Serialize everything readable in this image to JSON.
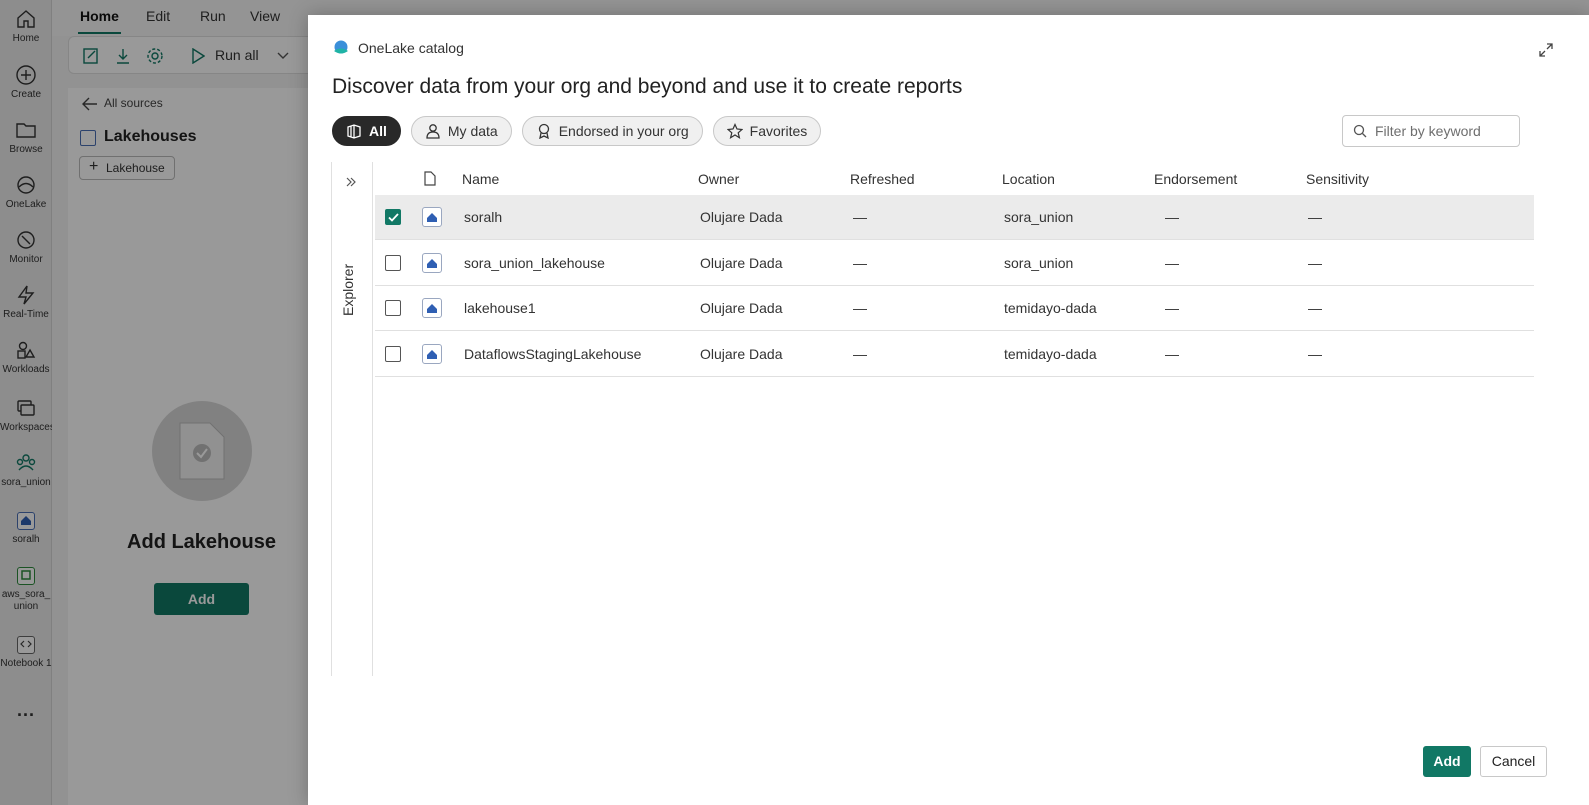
{
  "rail": {
    "items": [
      {
        "label": "Home",
        "icon": "home-icon"
      },
      {
        "label": "Create",
        "icon": "plus-circle-icon"
      },
      {
        "label": "Browse",
        "icon": "folder-icon"
      },
      {
        "label": "OneLake",
        "icon": "onelake-icon"
      },
      {
        "label": "Monitor",
        "icon": "monitor-icon"
      },
      {
        "label": "Real-Time",
        "icon": "lightning-icon"
      },
      {
        "label": "Workloads",
        "icon": "workloads-icon"
      },
      {
        "label": "Workspaces",
        "icon": "workspaces-icon"
      },
      {
        "label": "sora_union",
        "icon": "workspace-people-icon"
      },
      {
        "label": "soralh",
        "icon": "lakehouse-icon"
      },
      {
        "label": "aws_sora_union",
        "icon": "dataflow-icon"
      },
      {
        "label": "Notebook 1",
        "icon": "notebook-icon"
      }
    ],
    "more": "..."
  },
  "menubar": {
    "tabs": [
      "Home",
      "Edit",
      "Run",
      "View"
    ],
    "active_tab": "Home"
  },
  "toolbar": {
    "run_all": "Run all"
  },
  "left_panel": {
    "back_link": "All sources",
    "title": "Lakehouses",
    "add_chip": "Lakehouse",
    "empty_title": "Add Lakehouse",
    "add_button": "Add"
  },
  "dialog": {
    "header": "OneLake catalog",
    "title": "Discover data from your org and beyond and use it to create reports",
    "filters": [
      {
        "label": "All",
        "icon": "all-items-icon",
        "active": true
      },
      {
        "label": "My data",
        "icon": "person-icon",
        "active": false
      },
      {
        "label": "Endorsed in your org",
        "icon": "ribbon-icon",
        "active": false
      },
      {
        "label": "Favorites",
        "icon": "star-icon",
        "active": false
      }
    ],
    "search_placeholder": "Filter by keyword",
    "explorer_label": "Explorer",
    "columns": [
      "Name",
      "Owner",
      "Refreshed",
      "Location",
      "Endorsement",
      "Sensitivity"
    ],
    "rows": [
      {
        "name": "soralh",
        "owner": "Olujare Dada",
        "refreshed": "—",
        "location": "sora_union",
        "endorsement": "—",
        "sensitivity": "—",
        "checked": true
      },
      {
        "name": "sora_union_lakehouse",
        "owner": "Olujare Dada",
        "refreshed": "—",
        "location": "sora_union",
        "endorsement": "—",
        "sensitivity": "—",
        "checked": false
      },
      {
        "name": "lakehouse1",
        "owner": "Olujare Dada",
        "refreshed": "—",
        "location": "temidayo-dada",
        "endorsement": "—",
        "sensitivity": "—",
        "checked": false
      },
      {
        "name": "DataflowsStagingLakehouse",
        "owner": "Olujare Dada",
        "refreshed": "—",
        "location": "temidayo-dada",
        "endorsement": "—",
        "sensitivity": "—",
        "checked": false
      }
    ],
    "add_button": "Add",
    "cancel_button": "Cancel"
  },
  "colors": {
    "accent": "#117865",
    "chip_active": "#292929",
    "selected_row": "#ebebeb"
  }
}
